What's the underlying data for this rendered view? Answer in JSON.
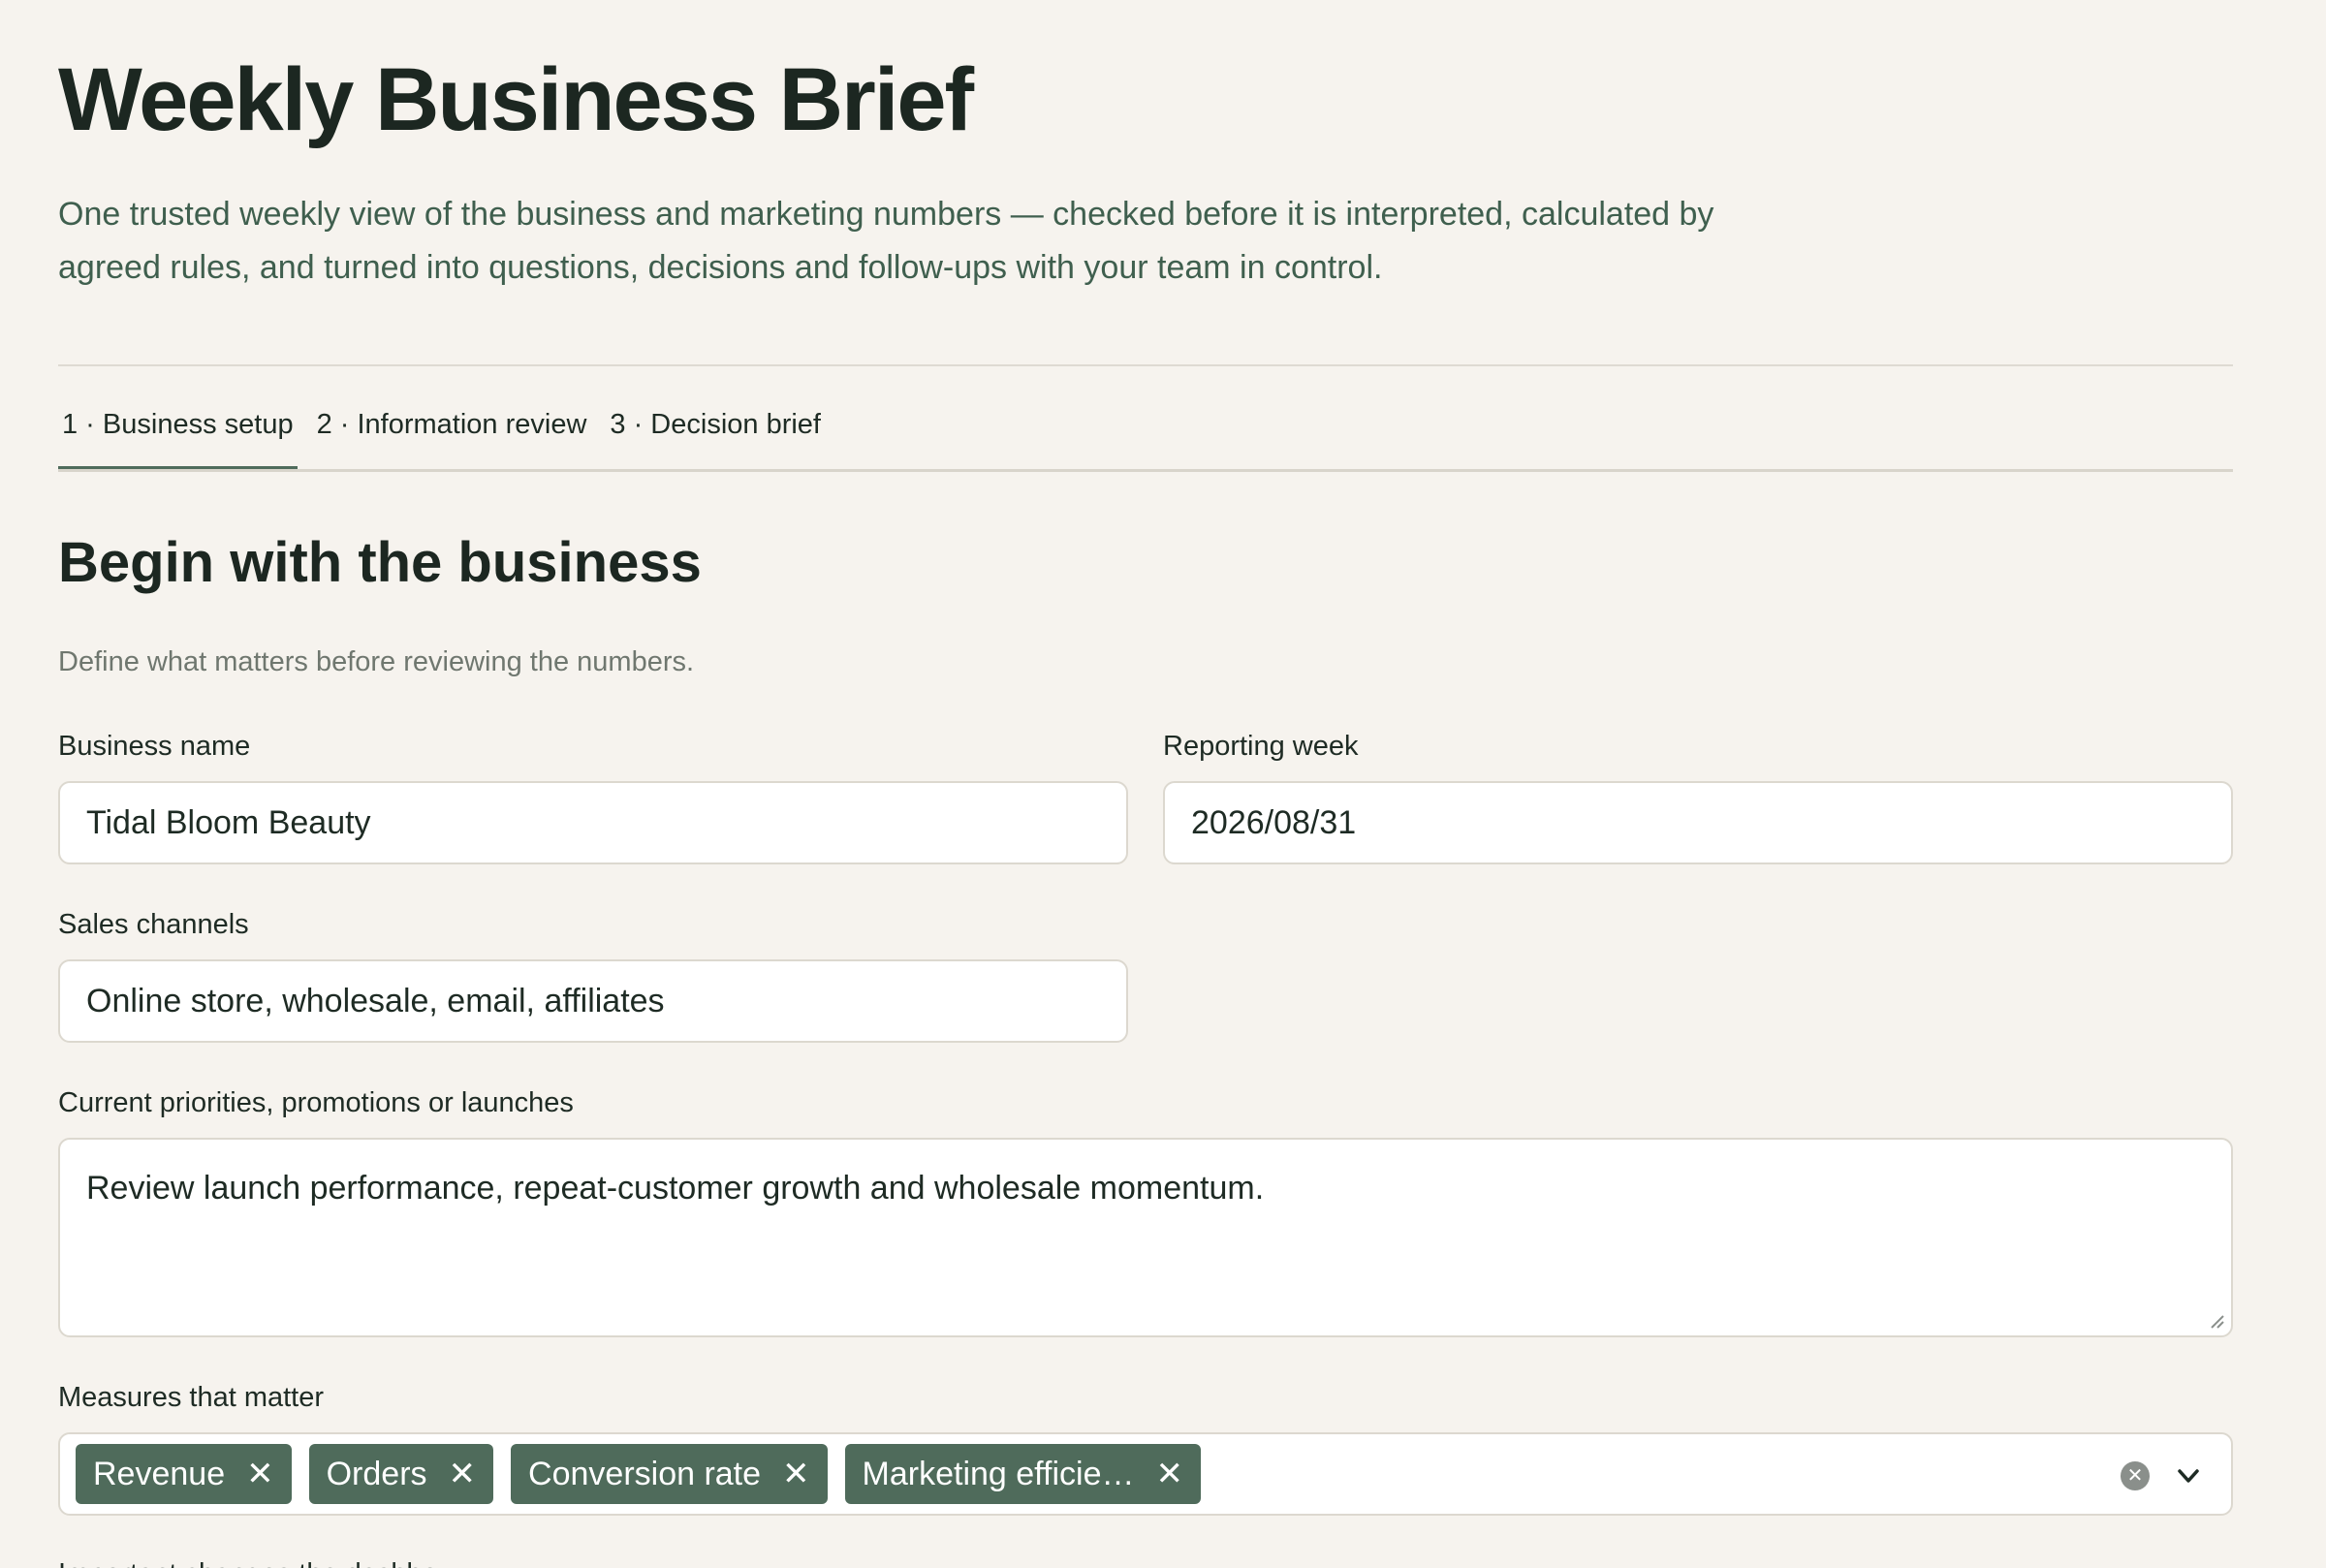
{
  "header": {
    "title": "Weekly Business Brief",
    "subtitle": "One trusted weekly view of the business and marketing numbers — checked before it is interpreted, calculated by agreed rules, and turned into questions, decisions and follow-ups with your team in control."
  },
  "tabs": [
    {
      "label": "1 · Business setup",
      "active": true
    },
    {
      "label": "2 · Information review",
      "active": false
    },
    {
      "label": "3 · Decision brief",
      "active": false
    }
  ],
  "section": {
    "title": "Begin with the business",
    "subtitle": "Define what matters before reviewing the numbers."
  },
  "form": {
    "business_name": {
      "label": "Business name",
      "value": "Tidal Bloom Beauty"
    },
    "reporting_week": {
      "label": "Reporting week",
      "value": "2026/08/31"
    },
    "sales_channels": {
      "label": "Sales channels",
      "value": "Online store, wholesale, email, affiliates"
    },
    "priorities": {
      "label": "Current priorities, promotions or launches",
      "value": "Review launch performance, repeat-customer growth and wholesale momentum."
    },
    "measures": {
      "label": "Measures that matter",
      "selected": [
        "Revenue",
        "Orders",
        "Conversion rate",
        "Marketing efficie…"
      ],
      "remove_glyph": "✕"
    },
    "next_label": "Important changes the dashbo"
  },
  "colors": {
    "background": "#f6f3ee",
    "accent": "#4f6b5b",
    "text": "#1e2b24",
    "muted": "#6f776f",
    "border": "#dcd8cf"
  },
  "icons": {
    "clear": "clear-circle-x-icon",
    "dropdown": "chevron-down-icon",
    "chip_remove": "close-icon",
    "resize": "resize-grip-icon"
  }
}
